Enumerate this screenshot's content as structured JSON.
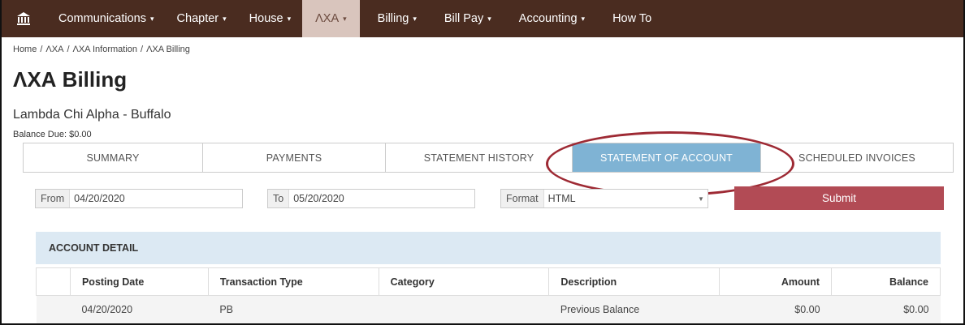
{
  "nav": {
    "home_icon": "bank-icon",
    "items": [
      {
        "label": "Communications",
        "caret": "▾",
        "active": false
      },
      {
        "label": "Chapter",
        "caret": "▾",
        "active": false
      },
      {
        "label": "House",
        "caret": "▾",
        "active": false
      },
      {
        "label": "ΛΧΑ",
        "caret": "▾",
        "active": true
      },
      {
        "label": "Billing",
        "caret": "▾",
        "active": false
      },
      {
        "label": "Bill Pay",
        "caret": "▾",
        "active": false
      },
      {
        "label": "Accounting",
        "caret": "▾",
        "active": false
      },
      {
        "label": "How To",
        "caret": "",
        "active": false
      }
    ],
    "colors": {
      "bar": "#4a2c20",
      "active_bg": "#d9c5bd"
    }
  },
  "breadcrumb": [
    "Home",
    "/",
    "ΛΧΑ",
    "/",
    "ΛΧΑ Information",
    "/",
    "ΛΧΑ Billing"
  ],
  "page": {
    "title": "ΛΧΑ Billing",
    "chapter": "Lambda Chi Alpha - Buffalo",
    "balance_due": "Balance Due: $0.00"
  },
  "tabs": [
    {
      "label": "SUMMARY",
      "active": false
    },
    {
      "label": "PAYMENTS",
      "active": false
    },
    {
      "label": "STATEMENT HISTORY",
      "active": false
    },
    {
      "label": "STATEMENT OF ACCOUNT",
      "active": true
    },
    {
      "label": "SCHEDULED INVOICES",
      "active": false
    }
  ],
  "filters": {
    "from_label": "From",
    "from_value": "04/20/2020",
    "to_label": "To",
    "to_value": "05/20/2020",
    "format_label": "Format",
    "format_value": "HTML",
    "submit_label": "Submit"
  },
  "account_detail": {
    "header": "ACCOUNT DETAIL",
    "columns": [
      "",
      "Posting Date",
      "Transaction Type",
      "Category",
      "Description",
      "Amount",
      "Balance"
    ],
    "rows": [
      [
        "",
        "04/20/2020",
        "PB",
        "",
        "Previous Balance",
        "$0.00",
        "$0.00"
      ]
    ]
  },
  "colors": {
    "accent_tab": "#7fb3d4",
    "submit": "#b24b55",
    "annotation": "#9e2a34",
    "section_bg": "#dce9f3"
  }
}
